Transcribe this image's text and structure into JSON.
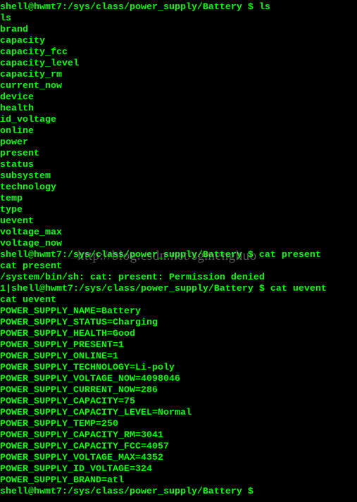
{
  "terminal": {
    "text_color": "#00ff00",
    "background": "#000000",
    "lines": [
      "shell@hwmt7:/sys/class/power_supply/Battery $ ls",
      "ls",
      "brand",
      "capacity",
      "capacity_fcc",
      "capacity_level",
      "capacity_rm",
      "current_now",
      "device",
      "health",
      "id_voltage",
      "online",
      "power",
      "present",
      "status",
      "subsystem",
      "technology",
      "temp",
      "type",
      "uevent",
      "voltage_max",
      "voltage_now",
      "shell@hwmt7:/sys/class/power_supply/Battery $ cat present",
      "cat present",
      "/system/bin/sh: cat: present: Permission denied",
      "1|shell@hwmt7:/sys/class/power_supply/Battery $ cat uevent",
      "cat uevent",
      "POWER_SUPPLY_NAME=Battery",
      "POWER_SUPPLY_STATUS=Charging",
      "POWER_SUPPLY_HEALTH=Good",
      "POWER_SUPPLY_PRESENT=1",
      "POWER_SUPPLY_ONLINE=1",
      "POWER_SUPPLY_TECHNOLOGY=Li-poly",
      "POWER_SUPPLY_VOLTAGE_NOW=4098046",
      "POWER_SUPPLY_CURRENT_NOW=286",
      "POWER_SUPPLY_CAPACITY=75",
      "POWER_SUPPLY_CAPACITY_LEVEL=Normal",
      "POWER_SUPPLY_TEMP=250",
      "POWER_SUPPLY_CAPACITY_RM=3041",
      "POWER_SUPPLY_CAPACITY_FCC=4057",
      "POWER_SUPPLY_VOLTAGE_MAX=4352",
      "POWER_SUPPLY_ID_VOLTAGE=324",
      "POWER_SUPPLY_BRAND=atl",
      "shell@hwmt7:/sys/class/power_supply/Battery $"
    ]
  },
  "watermark": "http://blog.csdn.net/sgmenghuo"
}
